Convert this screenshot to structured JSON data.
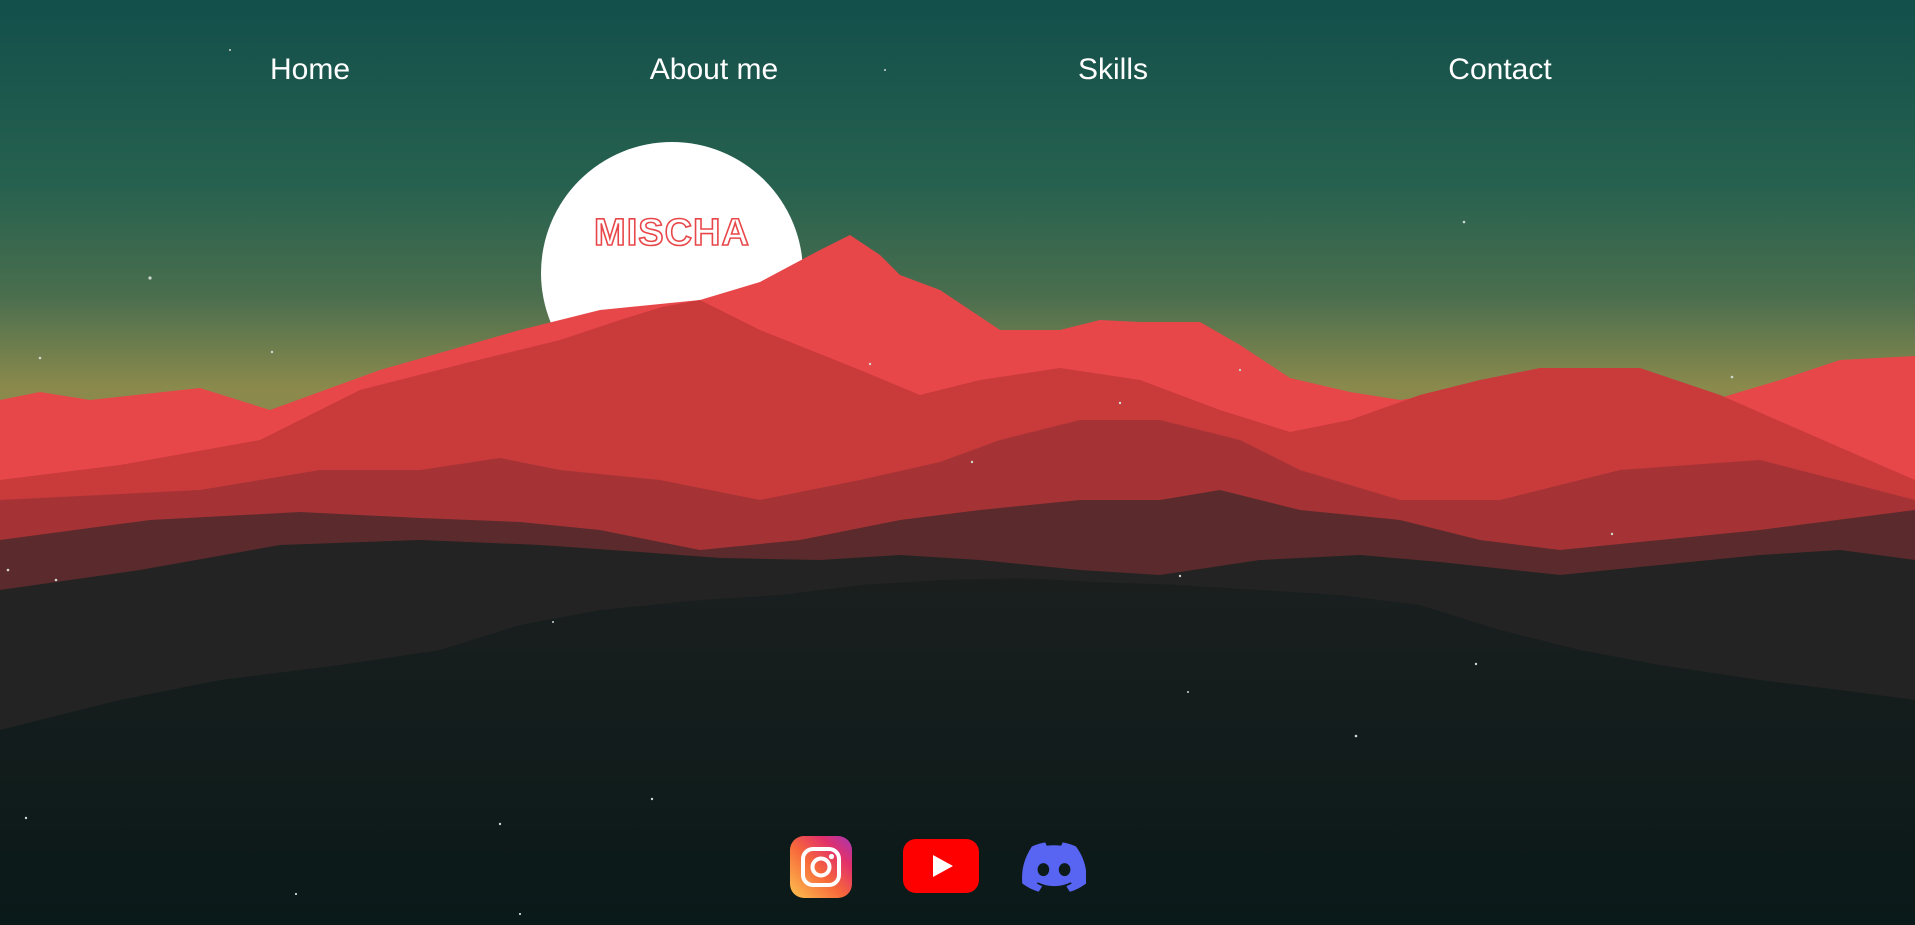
{
  "nav": {
    "items": [
      {
        "label": "Home"
      },
      {
        "label": "About me"
      },
      {
        "label": "Skills"
      },
      {
        "label": "Contact"
      }
    ]
  },
  "hero": {
    "logo_text": "MISCHA"
  },
  "social": {
    "icons": [
      "instagram-icon",
      "youtube-icon",
      "discord-icon"
    ]
  },
  "colors": {
    "sky_top": "#14504a",
    "sky_horizon": "#8a8a4a",
    "sun": "#ffffff",
    "mountain_bright": "#e8474a",
    "mountain_mid": "#c93a3b",
    "mountain_dark": "#1b1f1e",
    "instagram": "#e1306c",
    "youtube": "#ff0000",
    "discord": "#5865f2"
  }
}
